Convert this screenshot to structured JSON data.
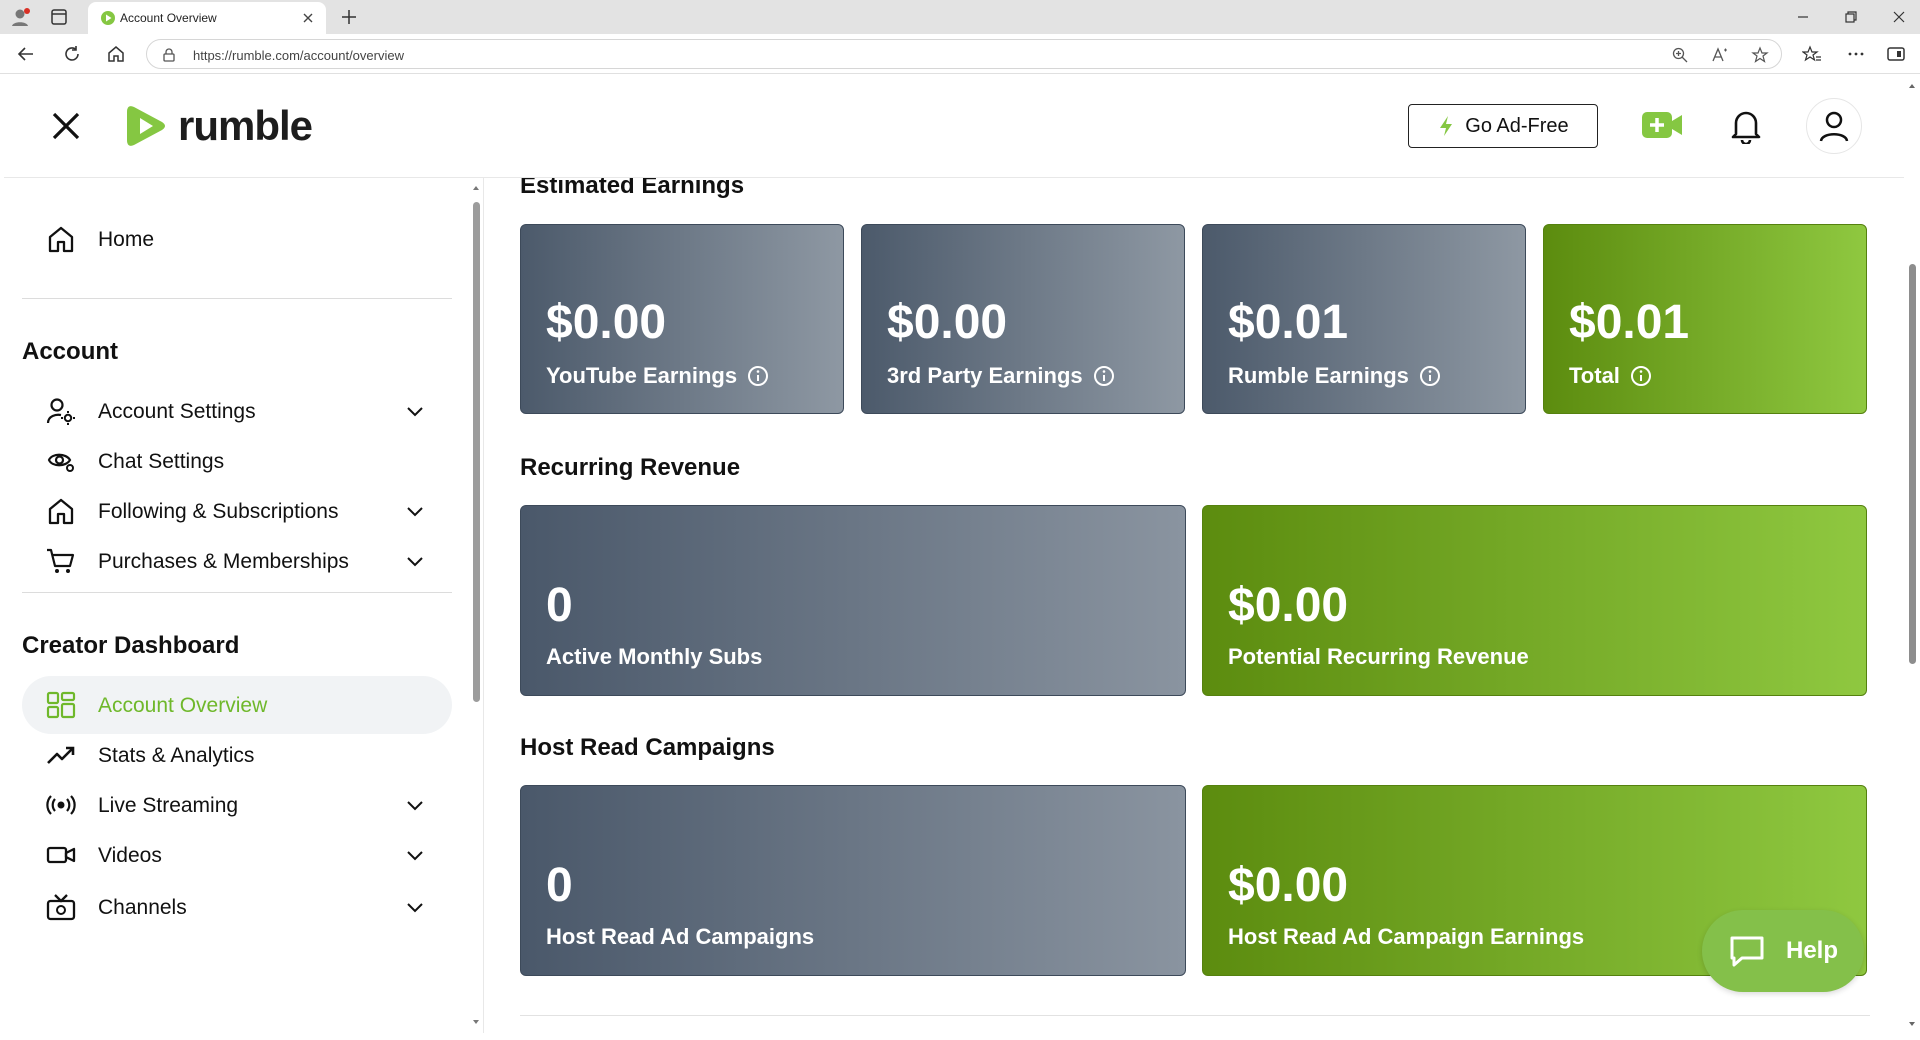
{
  "browser": {
    "tab_title": "Account Overview",
    "url": "https://rumble.com/account/overview"
  },
  "header": {
    "logo_text": "rumble",
    "ad_free_label": "Go Ad-Free"
  },
  "sidebar": {
    "home_label": "Home",
    "account_heading": "Account",
    "account_items": [
      {
        "label": "Account Settings"
      },
      {
        "label": "Chat Settings"
      },
      {
        "label": "Following & Subscriptions"
      },
      {
        "label": "Purchases & Memberships"
      }
    ],
    "creator_heading": "Creator Dashboard",
    "creator_items": [
      {
        "label": "Account Overview"
      },
      {
        "label": "Stats & Analytics"
      },
      {
        "label": "Live Streaming"
      },
      {
        "label": "Videos"
      },
      {
        "label": "Channels"
      }
    ]
  },
  "main": {
    "earnings_title": "Estimated Earnings",
    "earnings": [
      {
        "value": "$0.00",
        "label": "YouTube Earnings"
      },
      {
        "value": "$0.00",
        "label": "3rd Party Earnings"
      },
      {
        "value": "$0.01",
        "label": "Rumble Earnings"
      },
      {
        "value": "$0.01",
        "label": "Total"
      }
    ],
    "recurring_title": "Recurring Revenue",
    "recurring": [
      {
        "value": "0",
        "label": "Active Monthly Subs"
      },
      {
        "value": "$0.00",
        "label": "Potential Recurring Revenue"
      }
    ],
    "host_title": "Host Read Campaigns",
    "host": [
      {
        "value": "0",
        "label": "Host Read Ad Campaigns"
      },
      {
        "value": "$0.00",
        "label": "Host Read Ad Campaign Earnings"
      }
    ]
  },
  "help": {
    "label": "Help"
  },
  "colors": {
    "brand_green": "#85c742",
    "active_text": "#6fb82b",
    "card_gray_start": "#4c5a6b",
    "card_gray_end": "#8e98a3",
    "card_green_start": "#5c8c0f",
    "card_green_end": "#8fc840"
  }
}
